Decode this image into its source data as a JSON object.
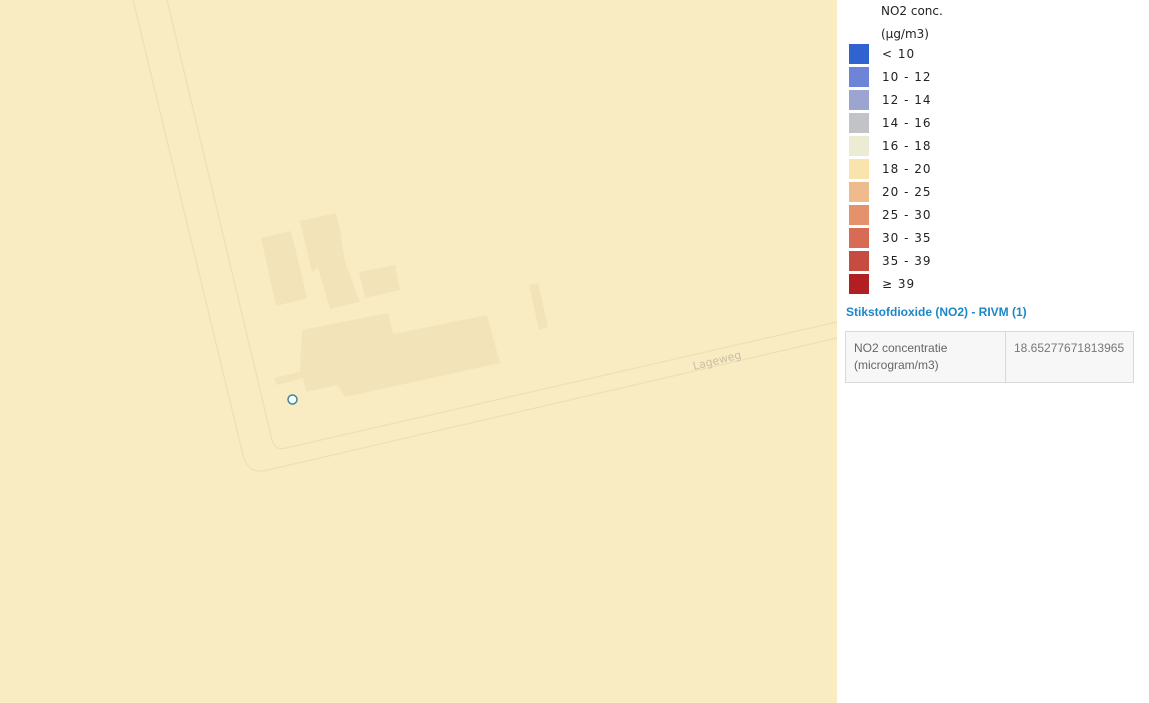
{
  "map": {
    "street_label": "Lageweg",
    "background_color": "#f9ebc2",
    "marker_icon": "location-circle-icon"
  },
  "legend": {
    "title_line1": "NO2 conc.",
    "title_line2": "(µg/m3)",
    "items": [
      {
        "label": "< 10",
        "color": "#3063cf"
      },
      {
        "label": "10 - 12",
        "color": "#6e84d7"
      },
      {
        "label": "12 - 14",
        "color": "#9ca4d1"
      },
      {
        "label": "14 - 16",
        "color": "#c2c3c6"
      },
      {
        "label": "16 - 18",
        "color": "#ecebd3"
      },
      {
        "label": "18 - 20",
        "color": "#f9e4ae"
      },
      {
        "label": "20 - 25",
        "color": "#eebc8c"
      },
      {
        "label": "25 - 30",
        "color": "#e4926c"
      },
      {
        "label": "30 - 35",
        "color": "#d76b55"
      },
      {
        "label": "35 - 39",
        "color": "#c64b40"
      },
      {
        "label": "≥ 39",
        "color": "#b11f22"
      }
    ]
  },
  "info": {
    "layer_title": "Stikstofdioxide (NO2) - RIVM (1)",
    "key_line1": "NO2 concentratie",
    "key_line2": "(microgram/m3)",
    "value": "18.65277671813965"
  }
}
